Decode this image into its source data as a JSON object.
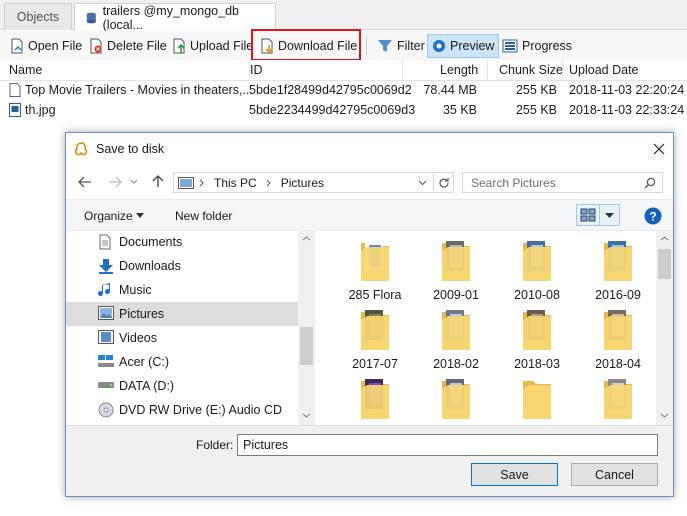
{
  "tabs": [
    {
      "label": "Objects"
    },
    {
      "label": "trailers @my_mongo_db (local..."
    }
  ],
  "toolbar": {
    "open_file": "Open File",
    "delete_file": "Delete File",
    "upload_file": "Upload File",
    "download_file": "Download File",
    "filter": "Filter",
    "preview": "Preview",
    "progress": "Progress"
  },
  "grid": {
    "columns": [
      "Name",
      "ID",
      "Length",
      "Chunk Size",
      "Upload Date"
    ],
    "rows": [
      {
        "name": "Top Movie Trailers - Movies in theaters,...",
        "id": "5bde1f28499d42795c0069d2",
        "length": "78.44 MB",
        "chunk": "255 KB",
        "date": "2018-11-03 22:20:24"
      },
      {
        "name": "th.jpg",
        "id": "5bde2234499d42795c0069d3",
        "length": "35 KB",
        "chunk": "255 KB",
        "date": "2018-11-03 22:33:24"
      }
    ]
  },
  "dialog": {
    "title": "Save to disk",
    "breadcrumb": [
      "This PC",
      "Pictures"
    ],
    "search_placeholder": "Search Pictures",
    "organize": "Organize",
    "new_folder": "New folder",
    "nav_items": [
      {
        "label": "Documents"
      },
      {
        "label": "Downloads"
      },
      {
        "label": "Music"
      },
      {
        "label": "Pictures"
      },
      {
        "label": "Videos"
      },
      {
        "label": "Acer (C:)"
      },
      {
        "label": "DATA (D:)"
      },
      {
        "label": "DVD RW Drive (E:) Audio CD"
      }
    ],
    "folders": [
      {
        "label": "285 Flora"
      },
      {
        "label": "2009-01"
      },
      {
        "label": "2010-08"
      },
      {
        "label": "2016-09"
      },
      {
        "label": "2017-07"
      },
      {
        "label": "2018-02"
      },
      {
        "label": "2018-03"
      },
      {
        "label": "2018-04"
      },
      {
        "label": ""
      },
      {
        "label": ""
      },
      {
        "label": ""
      },
      {
        "label": ""
      }
    ],
    "folder_label": "Folder:",
    "folder_value": "Pictures",
    "save": "Save",
    "cancel": "Cancel"
  }
}
